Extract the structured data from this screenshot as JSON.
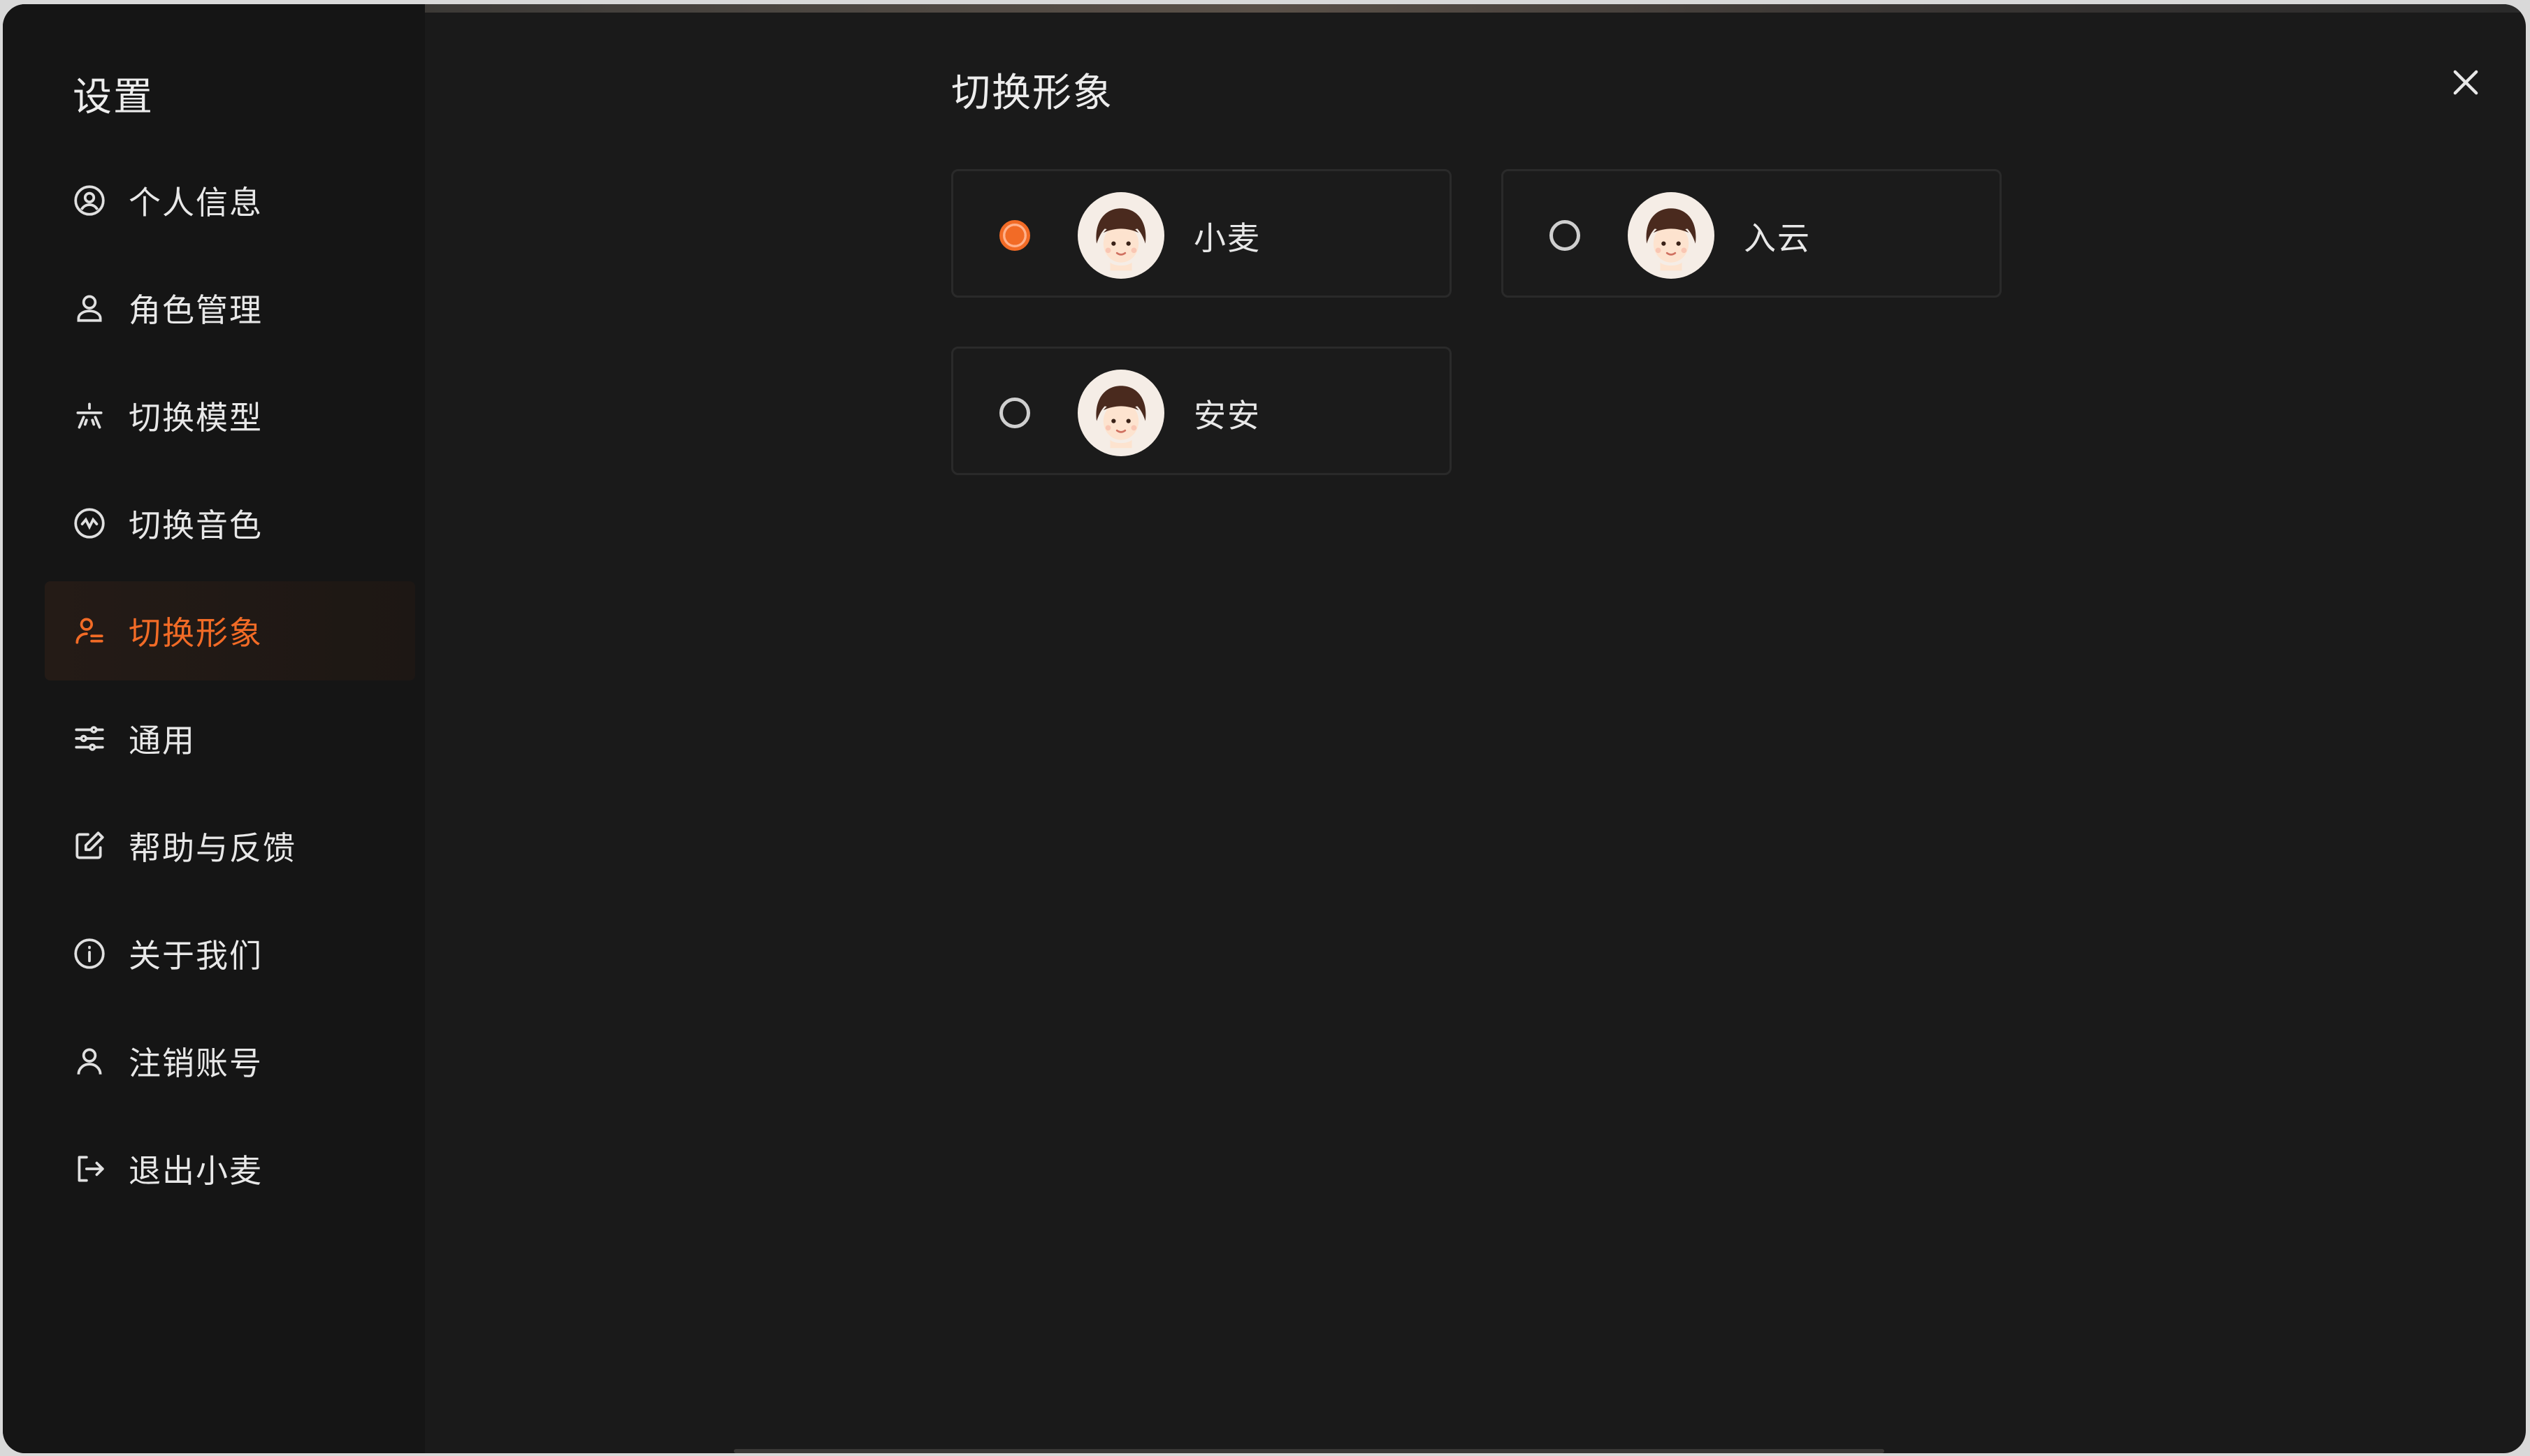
{
  "sidebar": {
    "title": "设置",
    "items": [
      {
        "label": "个人信息",
        "icon": "user-circle-icon",
        "active": false
      },
      {
        "label": "角色管理",
        "icon": "user-icon",
        "active": false
      },
      {
        "label": "切换模型",
        "icon": "model-icon",
        "active": false
      },
      {
        "label": "切换音色",
        "icon": "voice-swap-icon",
        "active": false
      },
      {
        "label": "切换形象",
        "icon": "avatar-switch-icon",
        "active": true
      },
      {
        "label": "通用",
        "icon": "sliders-icon",
        "active": false
      },
      {
        "label": "帮助与反馈",
        "icon": "edit-icon",
        "active": false
      },
      {
        "label": "关于我们",
        "icon": "info-icon",
        "active": false
      },
      {
        "label": "注销账号",
        "icon": "user-icon",
        "active": false
      },
      {
        "label": "退出小麦",
        "icon": "logout-icon",
        "active": false
      }
    ]
  },
  "main": {
    "title": "切换形象",
    "options": [
      {
        "name": "小麦",
        "selected": true,
        "icon": "avatar-girl-icon"
      },
      {
        "name": "入云",
        "selected": false,
        "icon": "avatar-girl-icon"
      },
      {
        "name": "安安",
        "selected": false,
        "icon": "avatar-girl-icon"
      }
    ]
  },
  "colors": {
    "accent": "#f26b26",
    "background": "#1a1a1a",
    "sidebar": "#151515",
    "text": "#e8e8e8"
  }
}
